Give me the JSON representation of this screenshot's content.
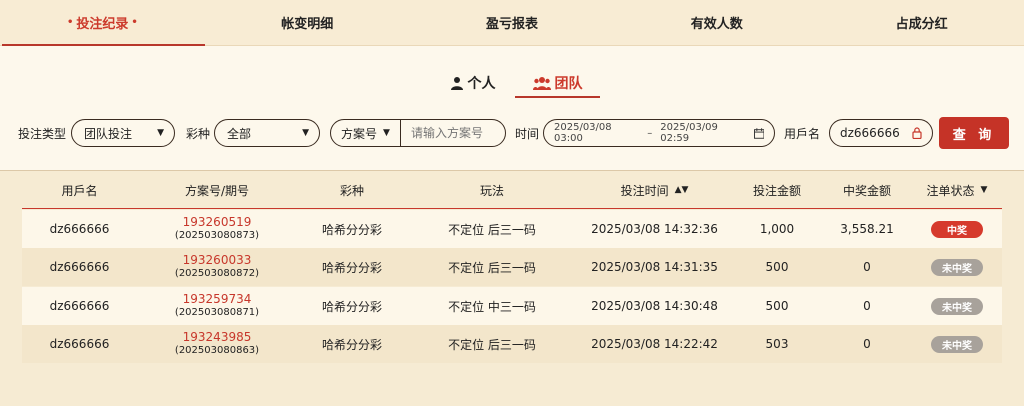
{
  "tabs": [
    "投注纪录",
    "帐变明细",
    "盈亏报表",
    "有效人数",
    "占成分红"
  ],
  "segments": [
    "个人",
    "团队"
  ],
  "filters": {
    "bet_type_label": "投注类型",
    "bet_type_value": "团队投注",
    "lottery_label": "彩种",
    "lottery_value": "全部",
    "plan_select": "方案号",
    "plan_placeholder": "请输入方案号",
    "time_label": "时间",
    "date_from": "2025/03/08 03:00",
    "date_sep": "–",
    "date_to": "2025/03/09 02:59",
    "username_label": "用戶名",
    "username_value": "dz666666",
    "query_button": "查 询"
  },
  "table": {
    "headers": [
      "用戶名",
      "方案号/期号",
      "彩种",
      "玩法",
      "投注时间",
      "投注金额",
      "中奖金额",
      "注单状态"
    ],
    "rows": [
      {
        "user": "dz666666",
        "plan": "193260519",
        "issue": "(202503080873)",
        "lottery": "哈希分分彩",
        "play": "不定位 后三一码",
        "time": "2025/03/08 14:32:36",
        "amount": "1,000",
        "win": "3,558.21",
        "status": "中奖"
      },
      {
        "user": "dz666666",
        "plan": "193260033",
        "issue": "(202503080872)",
        "lottery": "哈希分分彩",
        "play": "不定位 后三一码",
        "time": "2025/03/08 14:31:35",
        "amount": "500",
        "win": "0",
        "status": "未中奖"
      },
      {
        "user": "dz666666",
        "plan": "193259734",
        "issue": "(202503080871)",
        "lottery": "哈希分分彩",
        "play": "不定位 中三一码",
        "time": "2025/03/08 14:30:48",
        "amount": "500",
        "win": "0",
        "status": "未中奖"
      },
      {
        "user": "dz666666",
        "plan": "193243985",
        "issue": "(202503080863)",
        "lottery": "哈希分分彩",
        "play": "不定位 后三一码",
        "time": "2025/03/08 14:22:42",
        "amount": "503",
        "win": "0",
        "status": "未中奖"
      }
    ]
  },
  "colors": {
    "accent": "#c7372b",
    "background": "#f6ebd3",
    "panel": "#fdf8ec"
  }
}
